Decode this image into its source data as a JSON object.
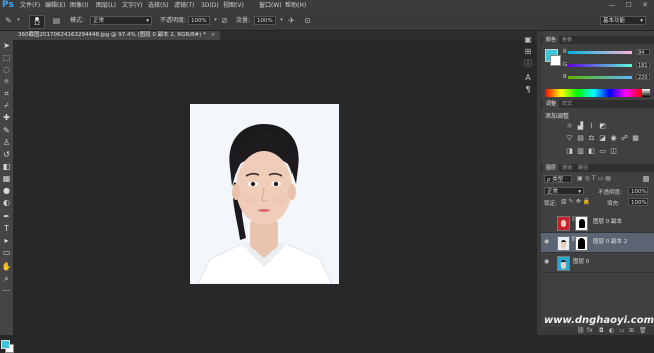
{
  "app": {
    "logo": "Ps"
  },
  "menubar": {
    "items": [
      "文件(F)",
      "编辑(E)",
      "图像(I)",
      "图层(L)",
      "文字(Y)",
      "选择(S)",
      "滤镜(T)",
      "3D(D)",
      "视图(V)",
      "窗口(W)",
      "帮助(H)"
    ],
    "window_controls": "— ☐ ✕"
  },
  "options": {
    "brush_size": "12",
    "mode_label": "模式:",
    "mode_value": "正常",
    "opacity_label": "不透明度:",
    "opacity_value": "100%",
    "flow_label": "流量:",
    "flow_value": "100%",
    "workspace": "基本功能"
  },
  "document": {
    "tab_title": "360截图20170624163294448.jpg @ 97.4% (图层 0 副本 2, RGB/8#) *"
  },
  "colors": {
    "foreground": "#3ec6d8",
    "background": "#ffffff",
    "accent": "#31a8ff"
  },
  "color_panel": {
    "tabs": [
      "颜色",
      "色板"
    ],
    "channels": [
      {
        "label": "R",
        "value": "94"
      },
      {
        "label": "G",
        "value": "181"
      },
      {
        "label": "B",
        "value": "220"
      }
    ]
  },
  "adjustments_panel": {
    "tabs": [
      "调整",
      "样式"
    ],
    "heading": "添加调整",
    "icons_row1": [
      "brightness-icon",
      "levels-icon",
      "curves-icon",
      "exposure-icon"
    ],
    "icons_row2": [
      "vibrance-icon",
      "hue-saturation-icon",
      "color-balance-icon",
      "black-white-icon",
      "photo-filter-icon",
      "channel-mixer-icon",
      "color-lookup-icon"
    ],
    "icons_row3": [
      "invert-icon",
      "posterize-icon",
      "threshold-icon",
      "gradient-map-icon",
      "selective-color-icon"
    ]
  },
  "layers_panel": {
    "tabs": [
      "图层",
      "通道",
      "路径"
    ],
    "filter_label": "ρ 类型",
    "blend_mode": "正常",
    "opacity_label": "不透明度:",
    "opacity_value": "100%",
    "lock_label": "锁定:",
    "fill_label": "填充:",
    "fill_value": "100%",
    "layers": [
      {
        "name": "图层 0 副本",
        "visible": false,
        "selected": false
      },
      {
        "name": "图层 0 副本 2",
        "visible": true,
        "selected": true
      },
      {
        "name": "图层 0",
        "visible": true,
        "selected": false
      }
    ],
    "footer_icons": [
      "link-icon",
      "fx-icon",
      "mask-icon",
      "adjustment-icon",
      "folder-icon",
      "new-layer-icon",
      "trash-icon"
    ]
  },
  "watermark": "www.dnghaoyi.com"
}
